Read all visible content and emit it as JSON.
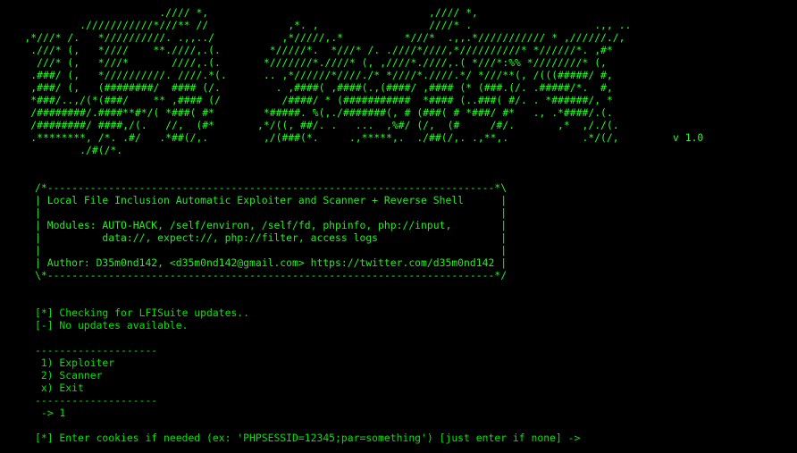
{
  "theme": {
    "background": "#000000",
    "text_color": "#22ff22"
  },
  "banner": {
    "lines": [
      "                          .//// *,                                    ,//// *,",
      "             .///////////*///** //             ,*. ,                  ////* .                    .,, ..",
      "    ,*///* /.   *//////////. .,,../           ,*/////,.*          *///*  .,,.*/////////// * ,//////./,",
      "     .///* (,   *////    **.////,.(.        */////*.  *///* /. .////*////,*//////////* *//////*. ,#*",
      "      ///* (,   *///*       ////,.(.       *///////*.////* (, ,////*.////,.( *///*:%% *////////* (,",
      "     .###/ (,   *//////////. ////.*(.      .. ,*//////*////./* *////*.////.*/ *///**(, /(((#####/ #,",
      "     ,###/ (,   (########/  #### (/.         . ,####( ,####(.,(####/ ,#### (* (###.(/. .#####/*.  #,",
      "     *###/..,/(*(###/    ** ,#### (/          /####/ * (###########  *#### (..###( #/. . *######/, *",
      "     /########/.####**#*/( *###( #*        *#####. %(,./#######(, # (###( # *###/ #*   ., .*####/.(.",
      "     /########/ ####,/(.   //,  (#*       ,*/((, ##/. .   ...  ,%#/ (/,  (#     /#/.       ,*  ,/./(.",
      "     .********, /*. .#/   .*##(/,.         ,/(###(*.     .,*****,.  ./##(/,. .,**,.            .*/(/,",
      "             ./#(/*."
    ],
    "version": "v 1.0"
  },
  "info_box": {
    "lines": [
      "/*-------------------------------------------------------------------------*\\",
      "| Local File Inclusion Automatic Exploiter and Scanner + Reverse Shell      |",
      "|                                                                           |",
      "| Modules: AUTO-HACK, /self/environ, /self/fd, phpinfo, php://input,        |",
      "|          data://, expect://, php://filter, access logs                    |",
      "|                                                                           |",
      "| Author: D35m0nd142, <d35m0nd142@gmail.com> https://twitter.com/d35m0nd142 |",
      "\\*-------------------------------------------------------------------------*/"
    ]
  },
  "status": {
    "checking": "[*] Checking for LFISuite updates..",
    "no_updates": "[-] No updates available."
  },
  "menu": {
    "separator_top": "--------------------",
    "options": [
      " 1) Exploiter",
      " 2) Scanner",
      " x) Exit"
    ],
    "separator_bottom": "--------------------",
    "selection": " -> 1"
  },
  "prompt": {
    "text": "[*] Enter cookies if needed (ex: 'PHPSESSID=12345;par=something') [just enter if none] ->"
  }
}
